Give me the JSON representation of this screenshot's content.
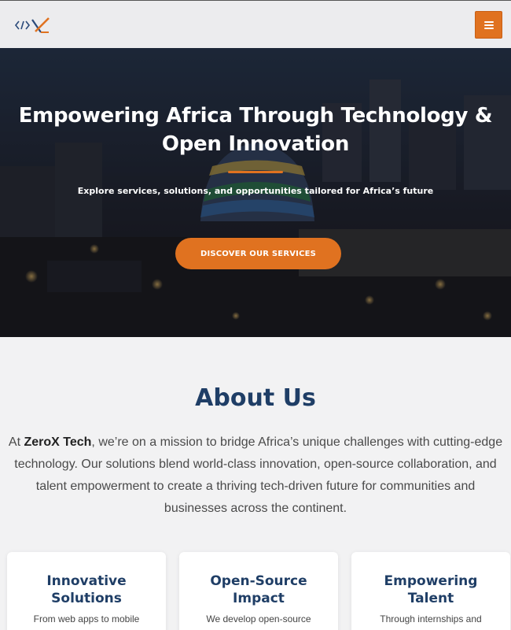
{
  "header": {
    "logo_icon": "zerox-logo",
    "menu_icon": "hamburger-icon",
    "accent": "#e07220"
  },
  "hero": {
    "title": "Empowering Africa Through Technology & Open Innovation",
    "subtitle": "Explore services, solutions, and opportunities tailored for Africa’s future",
    "cta_label": "DISCOVER OUR SERVICES"
  },
  "about": {
    "title": "About Us",
    "text_prefix": "At ",
    "brand": "ZeroX Tech",
    "text_body": ", we’re on a mission to bridge Africa’s unique challenges with cutting-edge technology. Our solutions blend world-class innovation, open-source collaboration, and talent empowerment to create a thriving tech-driven future for communities and businesses across the continent."
  },
  "cards": [
    {
      "title": "Innovative Solutions",
      "text": "From web apps to mobile"
    },
    {
      "title": "Open-Source Impact",
      "text": "We develop open-source"
    },
    {
      "title": "Empowering Talent",
      "text": "Through internships and"
    }
  ]
}
